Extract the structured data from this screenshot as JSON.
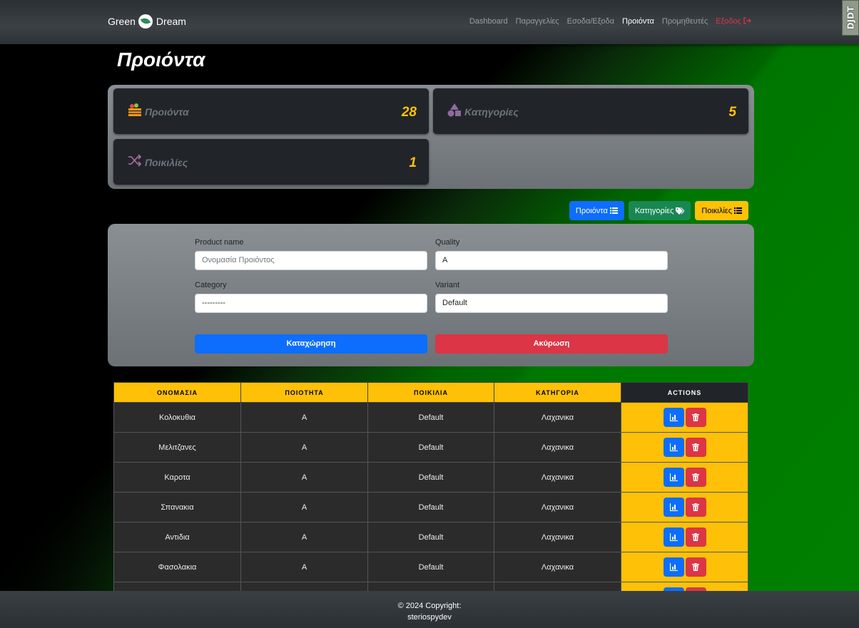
{
  "navbar": {
    "brand_left": "Green",
    "brand_right": "Dream",
    "links": [
      "Dashboard",
      "Παραγγελίες",
      "Εσοδα/Εξοδα",
      "Προιόντα",
      "Προμηθευτές",
      "Εξοδος"
    ],
    "active_index": 3,
    "debug_toolbar": "DJDT"
  },
  "page": {
    "title": "Προιόντα"
  },
  "stats": [
    {
      "label": "Προιόντα",
      "value": "28",
      "icon": "vegetable-crate-icon"
    },
    {
      "label": "Κατηγορίες",
      "value": "5",
      "icon": "shapes-icon"
    },
    {
      "label": "Ποικιλίες",
      "value": "1",
      "icon": "shuffle-icon"
    }
  ],
  "tab_buttons": {
    "products": "Προιόντα",
    "categories": "Κατηγορίες",
    "variants": "Ποικιλίες"
  },
  "form": {
    "product_name_label": "Product name",
    "product_name_placeholder": "Ονομασία Προιόντος",
    "quality_label": "Quality",
    "quality_value": "A",
    "category_label": "Category",
    "category_value": "---------",
    "variant_label": "Variant",
    "variant_value": "Default",
    "submit_label": "Καταχώρηση",
    "cancel_label": "Ακύρωση"
  },
  "table": {
    "headers": [
      "ΟΝΟΜΑΣΙΑ",
      "ΠΟΙΟΤΗΤΑ",
      "ΠΟΙΚΙΛΙΑ",
      "ΚΑΤΗΓΟΡΙΑ",
      "ACTIONS"
    ],
    "rows": [
      [
        "Κολοκυθια",
        "A",
        "Default",
        "Λαχανικα"
      ],
      [
        "Μελιτζανες",
        "A",
        "Default",
        "Λαχανικα"
      ],
      [
        "Καροτα",
        "A",
        "Default",
        "Λαχανικα"
      ],
      [
        "Σπανακια",
        "A",
        "Default",
        "Λαχανικα"
      ],
      [
        "Αντιδια",
        "A",
        "Default",
        "Λαχανικα"
      ],
      [
        "Φασολακια",
        "A",
        "Default",
        "Λαχανικα"
      ],
      [
        "",
        "",
        "",
        ""
      ]
    ]
  },
  "footer": {
    "copyright": "© 2024 Copyright:",
    "author": "steriospydev"
  },
  "colors": {
    "accent_yellow": "#ffc107",
    "primary_blue": "#0d6efd",
    "danger_red": "#dc3545",
    "success_green": "#198754"
  }
}
